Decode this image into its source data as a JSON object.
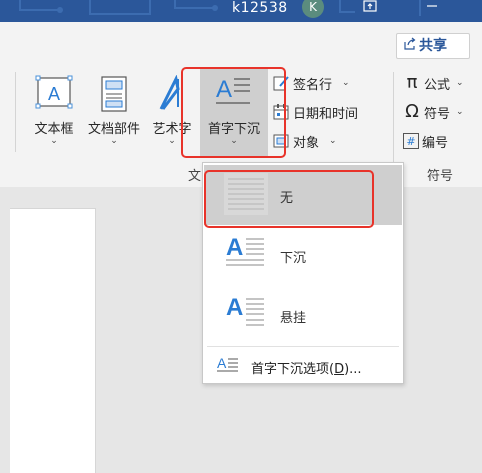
{
  "titlebar": {
    "username": "k12538",
    "avatar_letter": "K"
  },
  "share": {
    "label": "共享"
  },
  "ribbon": {
    "big_buttons": [
      {
        "label": "文本框"
      },
      {
        "label": "文档部件"
      },
      {
        "label": "艺术字"
      },
      {
        "label": "首字下沉"
      }
    ],
    "text_small": [
      {
        "label": "签名行"
      },
      {
        "label": "日期和时间"
      },
      {
        "label": "对象"
      }
    ],
    "symbol_small": [
      {
        "label": "公式",
        "glyph": "π"
      },
      {
        "label": "符号",
        "glyph": "Ω"
      },
      {
        "label": "编号",
        "glyph": "#"
      }
    ],
    "group_labels": {
      "text": "文",
      "symbols": "符号"
    }
  },
  "dropcap_menu": {
    "items": [
      {
        "label": "无",
        "selected": true
      },
      {
        "label": "下沉",
        "selected": false
      },
      {
        "label": "悬挂",
        "selected": false
      }
    ],
    "options_prefix": "首字下沉选项(",
    "options_mnemonic": "D",
    "options_suffix": ")..."
  },
  "colors": {
    "titlebar": "#2b579a",
    "accent": "#2b579a",
    "highlight": "#e8332a"
  }
}
